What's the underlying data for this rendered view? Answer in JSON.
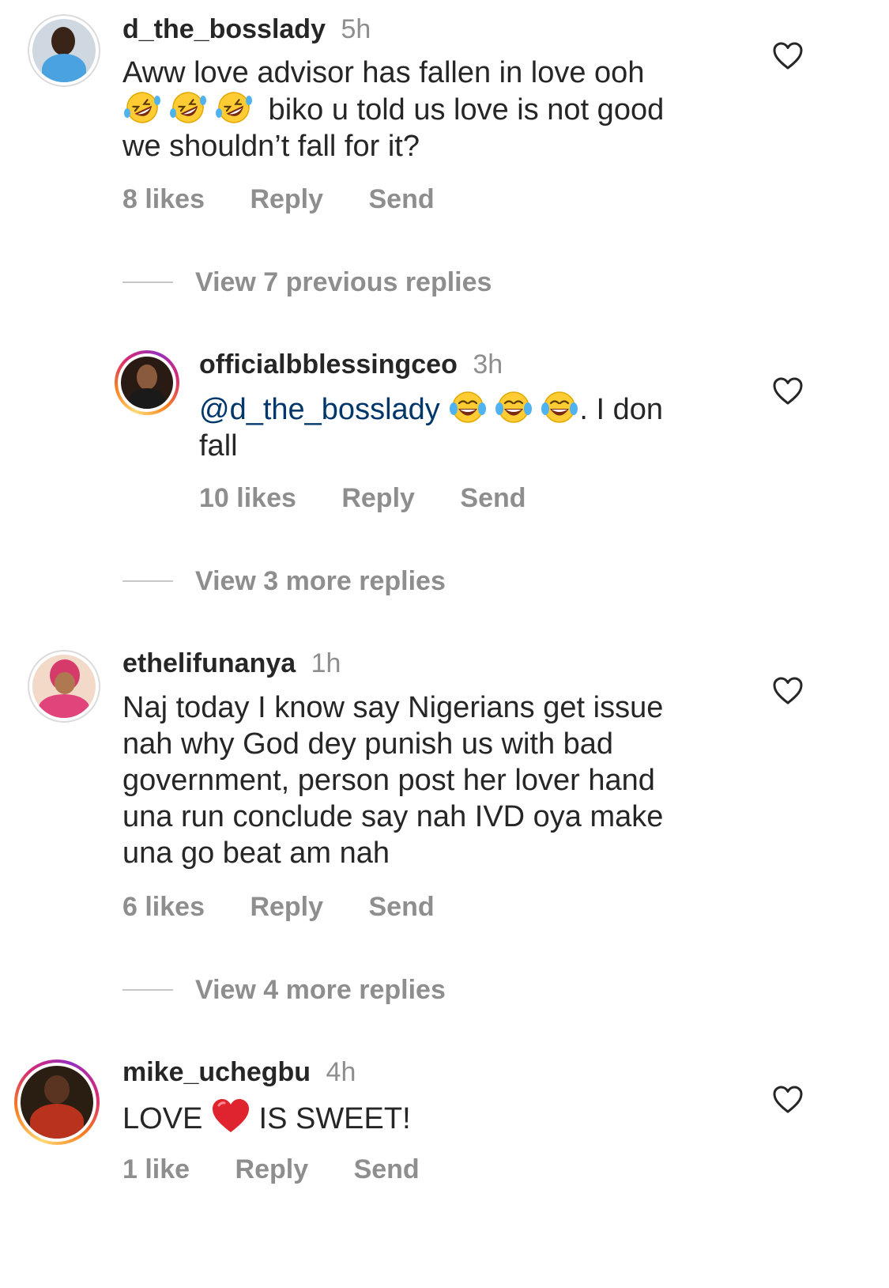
{
  "comments": [
    {
      "username": "d_the_bosslady",
      "time": "5h",
      "text_line1": "Aww love advisor has fallen in love ooh",
      "text_line2": " biko u told us love is not good",
      "text_line3": "we shouldn’t fall for it?",
      "likes": "8 likes",
      "reply": "Reply",
      "send": "Send",
      "view_replies": "View 7 previous replies"
    },
    {
      "username": "officialbblessingceo",
      "time": "3h",
      "mention": "@d_the_bosslady",
      "text_after": ". I don",
      "text_line2": "fall",
      "likes": "10 likes",
      "reply": "Reply",
      "send": "Send",
      "view_replies": "View 3 more replies"
    },
    {
      "username": "ethelifunanya",
      "time": "1h",
      "text_lines": [
        "Naj today I know say Nigerians get issue",
        "nah why God dey punish us with bad",
        "government, person post her lover hand",
        "una run conclude say nah IVD oya make",
        "una go beat am nah"
      ],
      "likes": "6 likes",
      "reply": "Reply",
      "send": "Send",
      "view_replies": "View 4 more replies"
    },
    {
      "username": "mike_uchegbu",
      "time": "4h",
      "text_before": "LOVE ",
      "text_after": " IS SWEET!",
      "likes": "1 like",
      "reply": "Reply",
      "send": "Send"
    }
  ],
  "icons": {
    "heart": "heart-outline-icon",
    "rofl": "rolling-on-floor-laughing-emoji",
    "joy": "face-with-tears-of-joy-emoji",
    "red_heart": "red-heart-emoji"
  },
  "colors": {
    "text": "#262626",
    "secondary": "#8e8e8e",
    "mention": "#00376b"
  }
}
